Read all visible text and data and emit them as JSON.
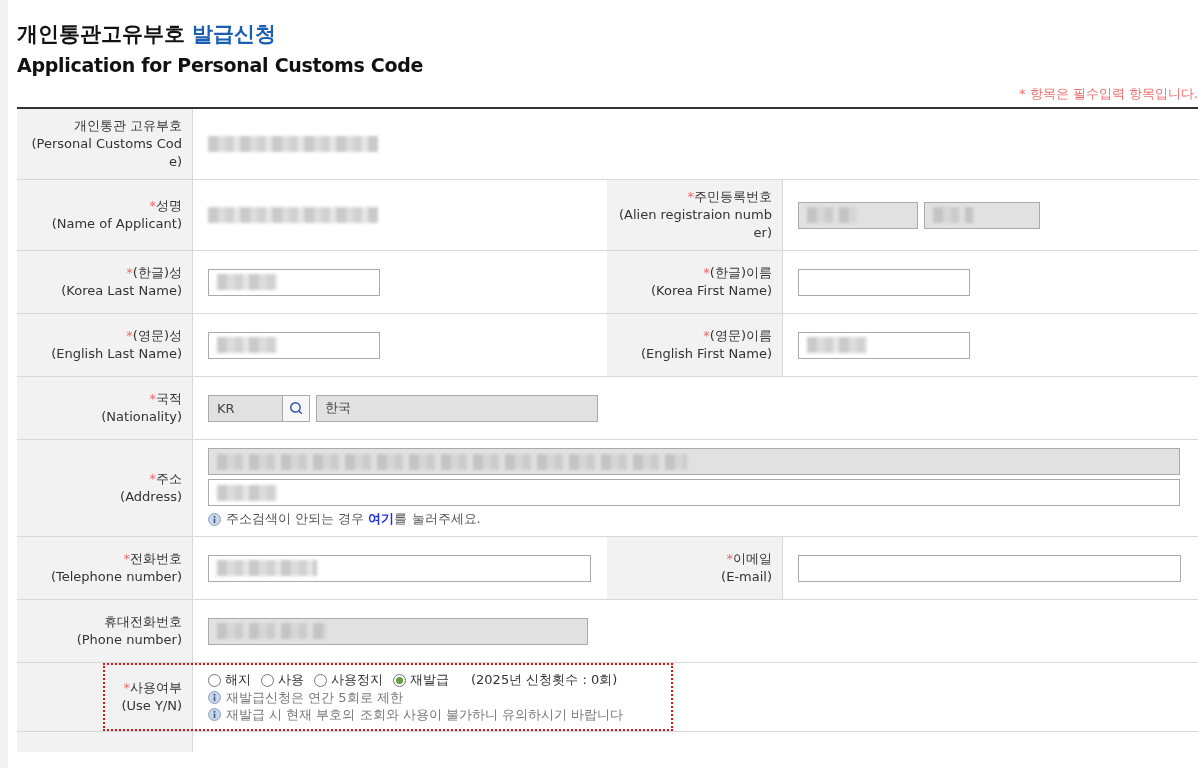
{
  "title": {
    "main": "개인통관고유부호",
    "accent": "발급신청",
    "english": "Application for Personal Customs Code"
  },
  "required_note": "* 항목은 필수입력 항목입니다.",
  "rows": [
    {
      "cells": [
        {
          "label": "개인통관 고유부호",
          "label_en": "(Personal Customs Code)",
          "field": {
            "kind": "plain",
            "blurred": true
          }
        }
      ]
    },
    {
      "cells": [
        {
          "mark": "*",
          "label": "성명",
          "label_en": "(Name of Applicant)",
          "field": {
            "kind": "plain",
            "blurred": true
          }
        },
        {
          "mark": "*",
          "label": "주민등록번호",
          "label_en": "(Alien registraion number)",
          "field": {
            "kind": "split",
            "blurred": true
          }
        }
      ]
    },
    {
      "cells": [
        {
          "mark": "*",
          "label": "(한글)성",
          "label_en": "(Korea Last Name)",
          "field": {
            "kind": "short_input",
            "blurred": true
          }
        },
        {
          "mark": "*",
          "label": "(한글)이름",
          "label_en": "(Korea First Name)",
          "field": {
            "kind": "short_input",
            "blurred": false
          }
        }
      ]
    },
    {
      "cells": [
        {
          "mark": "*",
          "label": "(영문)성",
          "label_en": "(English Last Name)",
          "field": {
            "kind": "short_input",
            "blurred": true
          }
        },
        {
          "mark": "*",
          "label": "(영문)이름",
          "label_en": "(English First Name)",
          "field": {
            "kind": "short_input",
            "blurred": true
          }
        }
      ]
    },
    {
      "cells": [
        {
          "mark": "*",
          "label": "국적",
          "label_en": "(Nationality)",
          "field": {
            "kind": "code_lookup",
            "code": "KR",
            "name": "한국"
          }
        }
      ]
    },
    {
      "cells": [
        {
          "mark": "*",
          "label": "주소",
          "label_en": "(Address)",
          "field": {
            "kind": "address",
            "blurred": true,
            "help": {
              "before": "주소검색이 안되는 경우 ",
              "link": "여기",
              "after": "를 눌러주세요."
            }
          }
        }
      ]
    },
    {
      "cells": [
        {
          "mark": "*",
          "label": "전화번호",
          "label_en": "(Telephone number)",
          "field": {
            "kind": "long_input",
            "blurred": true
          }
        },
        {
          "mark": "*",
          "label": "이메일",
          "label_en": "(E-mail)",
          "field": {
            "kind": "long_input",
            "blurred": false
          }
        }
      ]
    },
    {
      "cells": [
        {
          "label": "휴대전화번호",
          "label_en": "(Phone number)",
          "field": {
            "kind": "readonly",
            "blurred": true
          }
        }
      ]
    },
    {
      "highlighted": true,
      "cells": [
        {
          "mark": "*",
          "label": "사용여부",
          "label_en": "(Use Y/N)",
          "field": {
            "kind": "radio",
            "options": [
              {
                "label": "해지",
                "selected": false
              },
              {
                "label": "사용",
                "selected": false
              },
              {
                "label": "사용정지",
                "selected": false
              },
              {
                "label": "재발급",
                "selected": true
              }
            ],
            "count": "(2025년 신청횟수 : 0회)",
            "notes": [
              "재발급신청은 연간 5회로 제한",
              "재발급 시 현재 부호의 조회와 사용이 불가하니 유의하시기 바랍니다"
            ]
          }
        }
      ]
    }
  ]
}
